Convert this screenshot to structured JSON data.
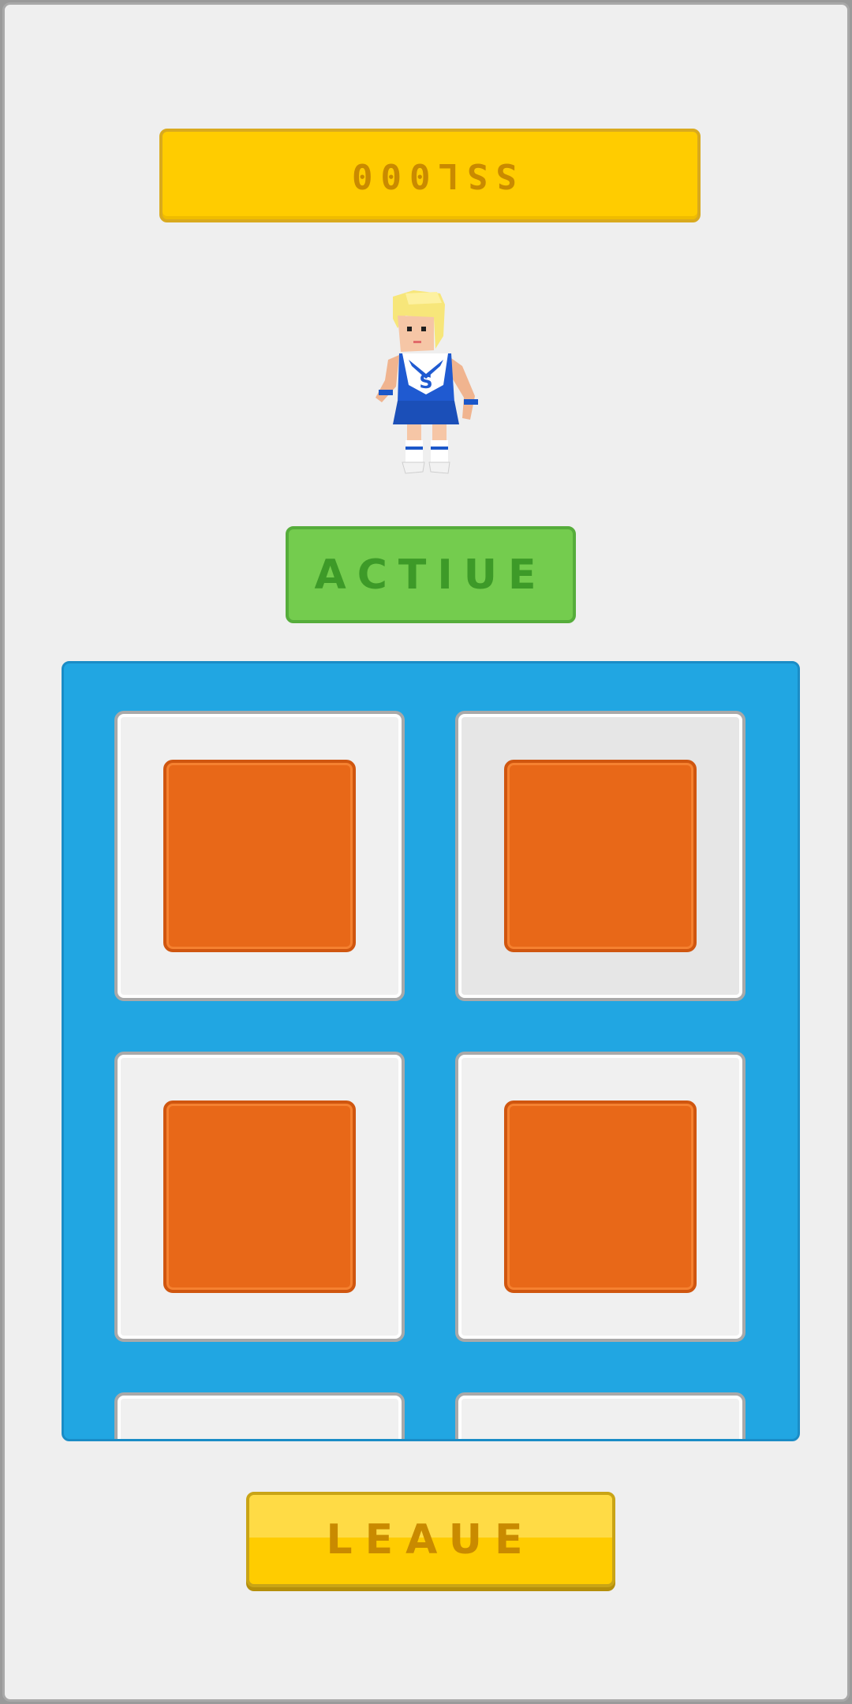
{
  "header": {
    "code": "SSL000"
  },
  "avatar": {
    "name": "cheerleader-avatar",
    "jersey_letter": "S"
  },
  "status": {
    "label": "ACTIUE"
  },
  "grid": {
    "tiles": [
      {
        "selected": false
      },
      {
        "selected": true
      },
      {
        "selected": false
      },
      {
        "selected": false
      },
      {
        "selected": false
      },
      {
        "selected": false
      }
    ]
  },
  "footer": {
    "leave_label": "LEAUE"
  },
  "colors": {
    "background": "#efefef",
    "banner": "#ffcc00",
    "status": "#74cc4e",
    "panel": "#21a6e2",
    "tile_fill": "#e86818"
  }
}
